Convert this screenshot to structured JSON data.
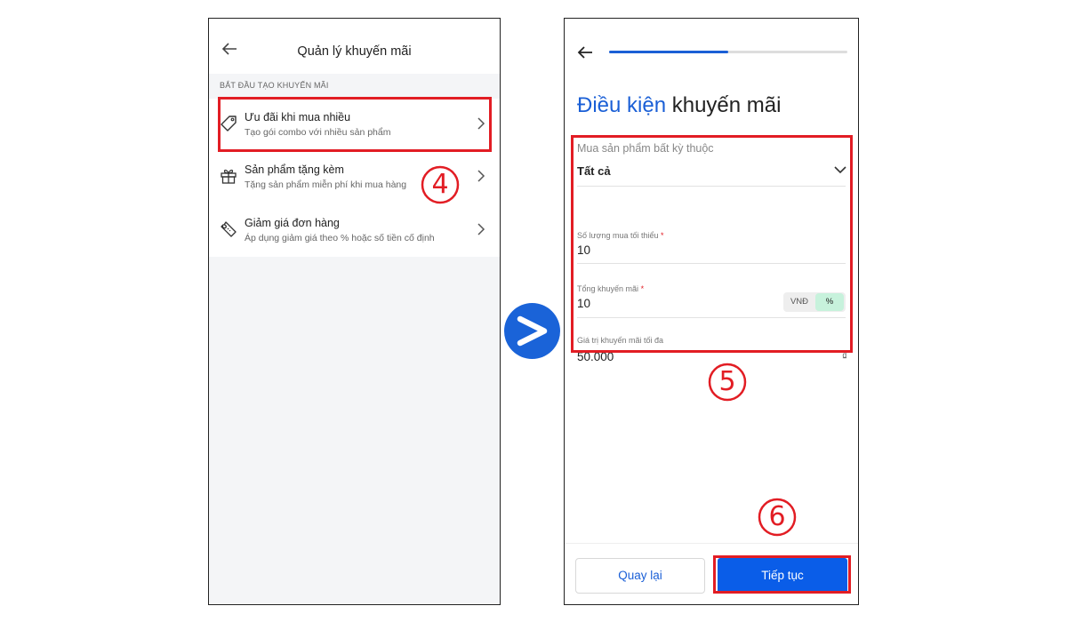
{
  "left": {
    "title": "Quản lý khuyến mãi",
    "section_label": "BẮT ĐẦU TẠO KHUYẾN MÃI",
    "items": [
      {
        "title": "Ưu đãi khi mua nhiều",
        "subtitle": "Tạo gói combo với nhiều sản phẩm",
        "icon": "tag-icon"
      },
      {
        "title": "Sản phẩm tặng kèm",
        "subtitle": "Tặng sản phẩm miễn phí khi mua hàng",
        "icon": "gift-icon"
      },
      {
        "title": "Giảm giá đơn hàng",
        "subtitle": "Áp dụng giảm giá theo % hoặc số tiền cố định",
        "icon": "ticket-icon"
      }
    ],
    "step_number": "4"
  },
  "right": {
    "title_accent": "Điều kiện",
    "title_rest": " khuyến mãi",
    "progress": 0.5,
    "form": {
      "category_label": "Mua sản phẩm bất kỳ thuộc",
      "category_value": "Tất cả",
      "min_qty_label": "Số lượng mua tối thiểu",
      "min_qty_value": "10",
      "total_label": "Tổng khuyến mãi",
      "total_value": "10",
      "unit_vnd": "VNĐ",
      "unit_percent": "%",
      "max_label": "Giá trị khuyến mãi tối đa",
      "max_value": "50.000",
      "currency": "₫",
      "required_mark": "*"
    },
    "back_button": "Quay lại",
    "next_button": "Tiếp tục",
    "step_form": "5",
    "step_next": "6"
  },
  "colors": {
    "accent_blue": "#1a5fd6",
    "highlight_red": "#e21d24",
    "arrow_blue": "#1a63d8",
    "toggle_green": "#c7f2dc"
  }
}
